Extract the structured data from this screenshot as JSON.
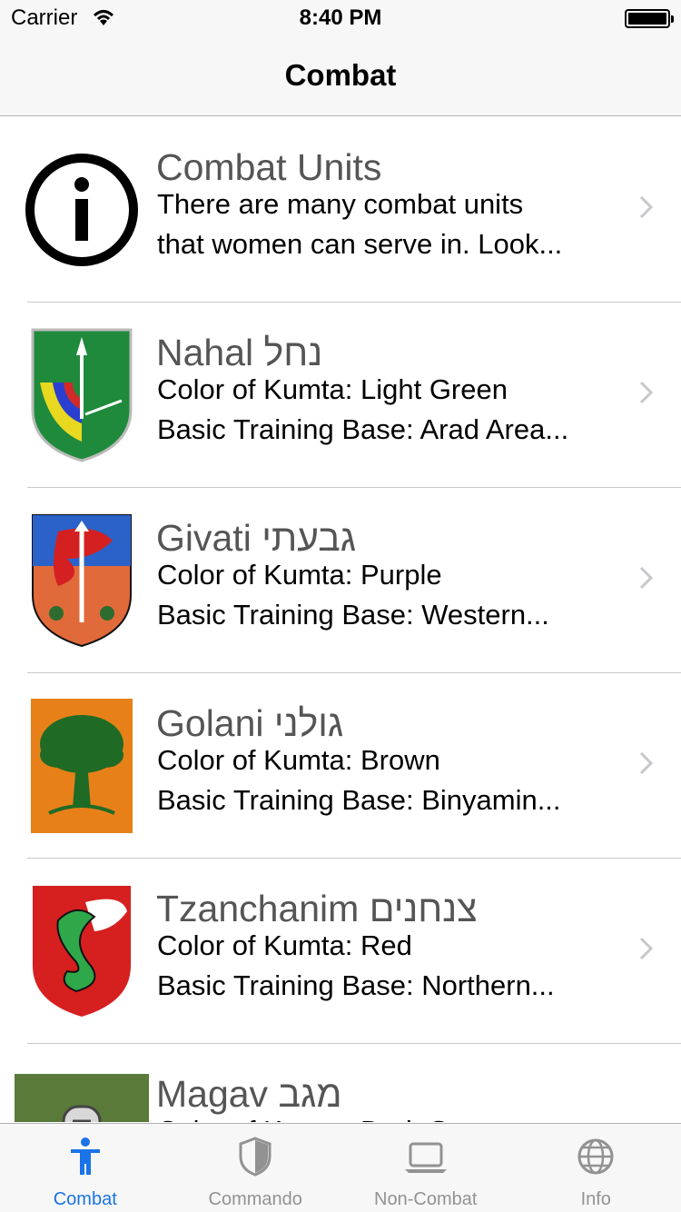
{
  "status_bar": {
    "carrier": "Carrier",
    "time": "8:40 PM"
  },
  "nav": {
    "title": "Combat"
  },
  "rows": [
    {
      "title": "Combat Units",
      "line1": "There are many combat units",
      "line2": "that women can serve in. Look..."
    },
    {
      "title": "Nahal נחל",
      "line1": "Color of Kumta: Light Green",
      "line2": "Basic Training Base: Arad Area..."
    },
    {
      "title": "Givati גבעתי",
      "line1": "Color of Kumta: Purple",
      "line2": "Basic Training Base: Western..."
    },
    {
      "title": "Golani גולני",
      "line1": "Color of Kumta: Brown",
      "line2": "Basic Training Base: Binyamin..."
    },
    {
      "title": "Tzanchanim צנחנים",
      "line1": "Color of Kumta: Red",
      "line2": "Basic Training Base: Northern..."
    },
    {
      "title": "Magav מגב",
      "line1": "Color of Kumta: Dark Green",
      "line2": ""
    }
  ],
  "tabs": [
    {
      "label": "Combat",
      "icon": "person-icon",
      "active": true
    },
    {
      "label": "Commando",
      "icon": "shield-icon",
      "active": false
    },
    {
      "label": "Non-Combat",
      "icon": "laptop-icon",
      "active": false
    },
    {
      "label": "Info",
      "icon": "globe-icon",
      "active": false
    }
  ],
  "colors": {
    "accent": "#1a73e8",
    "tab_inactive": "#929292",
    "title_gray": "#555555"
  }
}
